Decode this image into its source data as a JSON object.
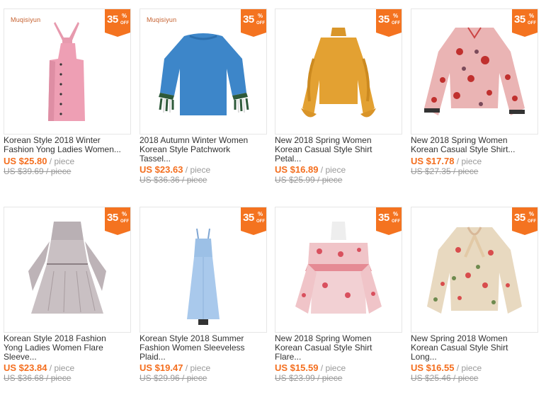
{
  "badge": {
    "number": "35",
    "percent": "%",
    "off": "OFF"
  },
  "products": [
    {
      "brand": "Muqisiyun",
      "title_1": "Korean Style 2018 Winter",
      "title_2": "Fashion Yong Ladies Women...",
      "title_3": "",
      "price": "US $25.80",
      "unit": " / piece",
      "original": "US $39.69 / piece",
      "item": "pink pinafore dress"
    },
    {
      "brand": "Muqisiyun",
      "title_1": "2018 Autumn Winter Women",
      "title_2": "Korean Style Patchwork",
      "title_3": "Tassel...",
      "price": "US $23.63",
      "unit": " / piece",
      "original": "US $36.36 / piece",
      "item": "blue knit sweater"
    },
    {
      "brand": "",
      "title_1": "New 2018 Spring Women",
      "title_2": "Korean Casual Style Shirt",
      "title_3": "Petal...",
      "price": "US $16.89",
      "unit": " / piece",
      "original": "US $25.99 / piece",
      "item": "mustard ruffle blouse"
    },
    {
      "brand": "",
      "title_1": "New 2018 Spring Women",
      "title_2": "Korean Casual Style Shirt...",
      "title_3": "",
      "price": "US $17.78",
      "unit": " / piece",
      "original": "US $27.35 / piece",
      "item": "floral print blouse"
    },
    {
      "brand": "",
      "title_1": "Korean Style 2018 Fashion",
      "title_2": "Yong Ladies Women Flare",
      "title_3": "Sleeve...",
      "price": "US $23.84",
      "unit": " / piece",
      "original": "US $36.68 / piece",
      "item": "grey flare sleeve dress"
    },
    {
      "brand": "",
      "title_1": "Korean Style 2018 Summer",
      "title_2": "Fashion Women Sleeveless",
      "title_3": "Plaid...",
      "price": "US $19.47",
      "unit": " / piece",
      "original": "US $29.96 / piece",
      "item": "light blue maxi dress"
    },
    {
      "brand": "",
      "title_1": "New 2018 Spring Women",
      "title_2": "Korean Casual Style Shirt",
      "title_3": "Flare...",
      "price": "US $15.59",
      "unit": " / piece",
      "original": "US $23.99 / piece",
      "item": "off-shoulder floral top"
    },
    {
      "brand": "",
      "title_1": "New Spring 2018 Women",
      "title_2": "Korean Casual Style Shirt",
      "title_3": "Long...",
      "price": "US $16.55",
      "unit": " / piece",
      "original": "US $25.46 / piece",
      "item": "floral bow blouse"
    }
  ]
}
